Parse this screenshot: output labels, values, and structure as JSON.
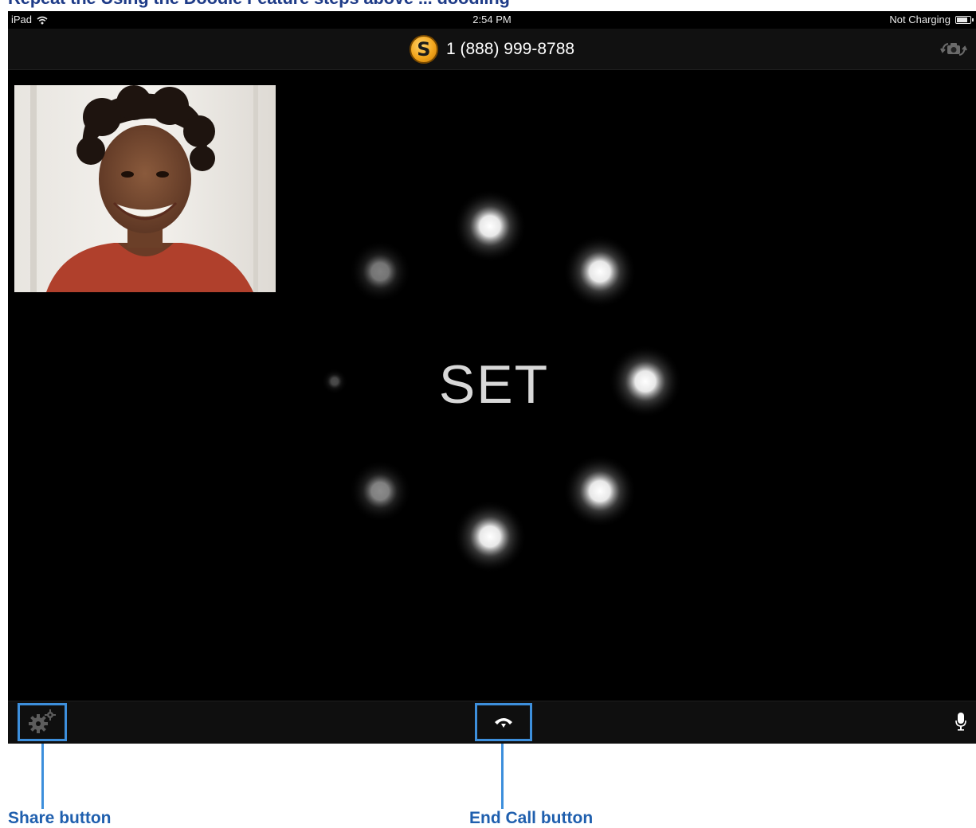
{
  "top_caption": "Repeat the Using the Doodle Feature steps above ... doodling",
  "status_bar": {
    "device": "iPad",
    "time": "2:54 PM",
    "charging": "Not Charging"
  },
  "nav": {
    "logo_letter": "S",
    "phone_number": "1 (888) 999-8788",
    "camera_switch_icon": "camera-switch-icon"
  },
  "main": {
    "center_text": "SET",
    "loader_icon": "spinner-dots"
  },
  "toolbar": {
    "share_icon": "gear-icon",
    "end_call_icon": "hang-up-phone-icon",
    "mic_icon": "microphone-icon"
  },
  "callouts": {
    "share_label": "Share button",
    "end_call_label": "End Call button"
  },
  "colors": {
    "callout_blue": "#3d8fdc",
    "logo_orange": "#f2a51c"
  }
}
